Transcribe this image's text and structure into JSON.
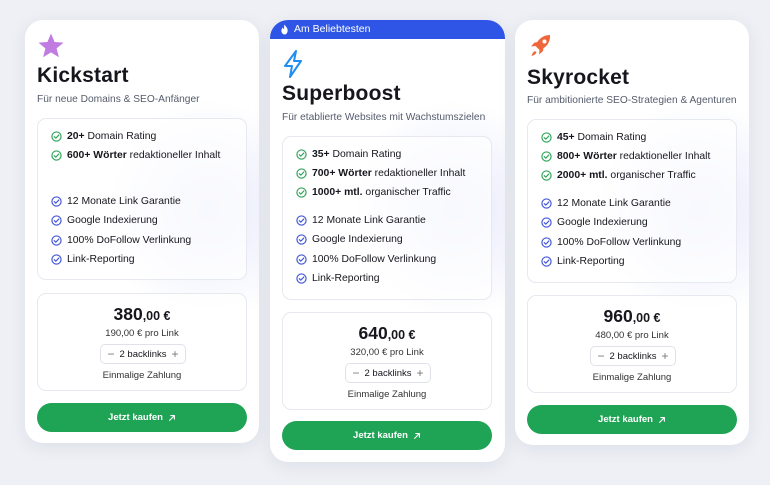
{
  "colors": {
    "accent_blue": "#2f55e6",
    "buy_green": "#1fa354",
    "check_green": "#31a35a",
    "check_blue": "#4256d6",
    "star_purple": "#c07ce0",
    "bolt_blue": "#1f8ef0",
    "rocket_orange": "#f0663b"
  },
  "plans": [
    {
      "icon": "star-icon",
      "name": "Kickstart",
      "subtitle": "Für neue Domains & SEO-Anfänger",
      "highlights": [
        {
          "bold": "20+",
          "text": " Domain Rating"
        },
        {
          "bold": "600+ Wörter",
          "text": " redaktioneller Inhalt"
        }
      ],
      "features": [
        "12 Monate Link Garantie",
        "Google Indexierung",
        "100% DoFollow Verlinkung",
        "Link-Reporting"
      ],
      "price_main": "380",
      "price_dec": ",00 €",
      "per_link": "190,00 € pro Link",
      "backlinks": "2 backlinks",
      "payment": "Einmalige Zahlung",
      "button": "Jetzt kaufen"
    },
    {
      "badge": "Am Beliebtesten",
      "icon": "lightning-icon",
      "name": "Superboost",
      "subtitle": "Für etablierte Websites mit Wachstumszielen",
      "highlights": [
        {
          "bold": "35+",
          "text": " Domain Rating"
        },
        {
          "bold": "700+ Wörter",
          "text": " redaktioneller Inhalt"
        },
        {
          "bold": "1000+ mtl.",
          "text": " organischer Traffic"
        }
      ],
      "features": [
        "12 Monate Link Garantie",
        "Google Indexierung",
        "100% DoFollow Verlinkung",
        "Link-Reporting"
      ],
      "price_main": "640",
      "price_dec": ",00 €",
      "per_link": "320,00 € pro Link",
      "backlinks": "2 backlinks",
      "payment": "Einmalige Zahlung",
      "button": "Jetzt kaufen"
    },
    {
      "icon": "rocket-icon",
      "name": "Skyrocket",
      "subtitle": "Für ambitionierte SEO-Strategien & Agenturen",
      "highlights": [
        {
          "bold": "45+",
          "text": " Domain Rating"
        },
        {
          "bold": "800+ Wörter",
          "text": " redaktioneller Inhalt"
        },
        {
          "bold": "2000+ mtl.",
          "text": " organischer Traffic"
        }
      ],
      "features": [
        "12 Monate Link Garantie",
        "Google Indexierung",
        "100% DoFollow Verlinkung",
        "Link-Reporting"
      ],
      "price_main": "960",
      "price_dec": ",00 €",
      "per_link": "480,00 € pro Link",
      "backlinks": "2 backlinks",
      "payment": "Einmalige Zahlung",
      "button": "Jetzt kaufen"
    }
  ],
  "stepper": {
    "minus": "−",
    "plus": "+"
  }
}
